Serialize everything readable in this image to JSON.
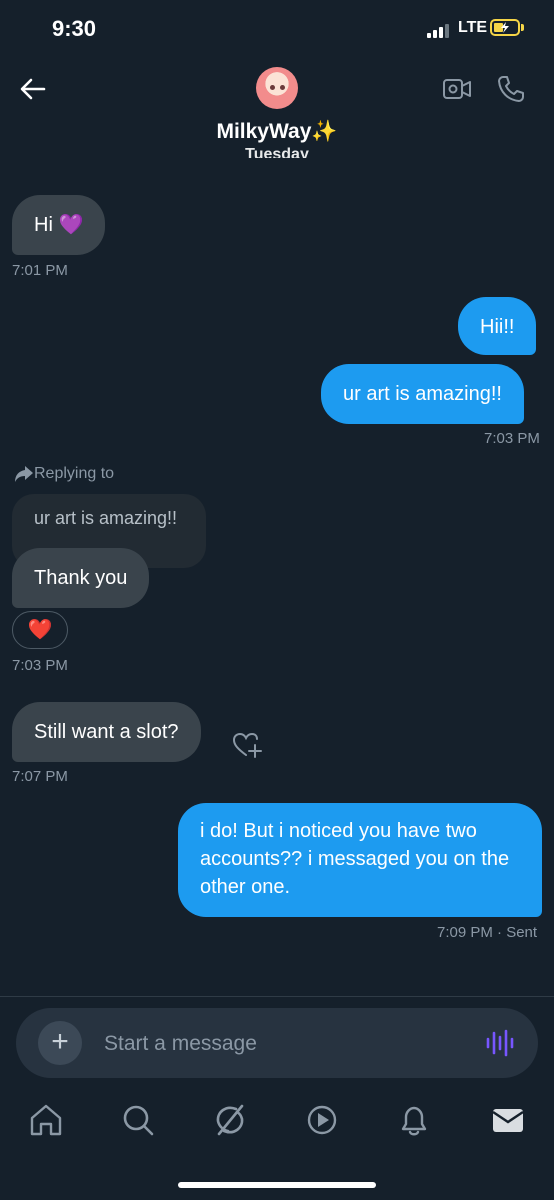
{
  "status_bar": {
    "time": "9:30",
    "network": "LTE"
  },
  "header": {
    "contact_name": "MilkyWay",
    "contact_emoji": "✨",
    "date_divider": "Tuesday"
  },
  "messages": [
    {
      "text": "Hi 💜",
      "time": "7:01 PM"
    },
    {
      "text": "Hii!!"
    },
    {
      "text": "ur art is amazing!!",
      "time": "7:03 PM"
    },
    {
      "reply_label": "Replying to",
      "quoted": "ur art is amazing!!",
      "text": "Thank you",
      "reaction": "❤️",
      "time": "7:03 PM"
    },
    {
      "text": "Still want a slot?",
      "time": "7:07 PM"
    },
    {
      "text": "i do! But i noticed you have two accounts?? i messaged you on the other one.",
      "time": "7:09 PM",
      "status": "· Sent"
    }
  ],
  "composer": {
    "placeholder": "Start a message",
    "plus": "+"
  },
  "tabs": [
    {
      "icon": "home-icon"
    },
    {
      "icon": "search-icon"
    },
    {
      "icon": "grok-icon"
    },
    {
      "icon": "play-icon"
    },
    {
      "icon": "bell-icon"
    },
    {
      "icon": "mail-icon"
    }
  ],
  "colors": {
    "background": "#15202b",
    "accent": "#1d9bf0",
    "incoming": "#3a444c",
    "voice": "#7856ff"
  }
}
